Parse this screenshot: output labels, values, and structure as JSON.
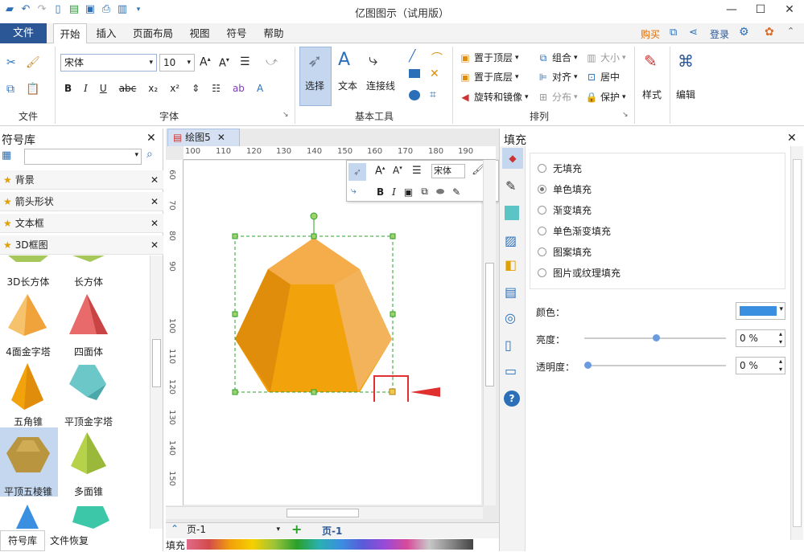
{
  "window": {
    "title": "亿图图示（试用版）"
  },
  "menu": {
    "file": "文件",
    "tabs": [
      "开始",
      "插入",
      "页面布局",
      "视图",
      "符号",
      "帮助"
    ],
    "right": {
      "buy": "购买",
      "login": "登录"
    }
  },
  "ribbon": {
    "groups": {
      "file": "文件",
      "font": "字体",
      "basic_tools": "基本工具",
      "arrange": "排列"
    },
    "font_name": "宋体",
    "font_size": "10",
    "select": "选择",
    "text": "文本",
    "connector": "连接线",
    "arrange_items": [
      "置于顶层",
      "置于底层",
      "旋转和镜像",
      "组合",
      "对齐",
      "分布",
      "大小",
      "居中",
      "保护"
    ],
    "style": "样式",
    "edit": "编辑"
  },
  "sidebar": {
    "title": "符号库",
    "libraries": [
      "背景",
      "箭头形状",
      "文本框",
      "3D框图"
    ],
    "shapes": [
      {
        "label": "3D长方体",
        "icon": "cuboid-3d-icon"
      },
      {
        "label": "长方体",
        "icon": "cuboid-icon"
      },
      {
        "label": "4面金字塔",
        "icon": "pyramid-4-face-icon"
      },
      {
        "label": "四面体",
        "icon": "tetrahedron-icon"
      },
      {
        "label": "五角锥",
        "icon": "pentagonal-pyramid-icon"
      },
      {
        "label": "平顶金字塔",
        "icon": "flat-top-pyramid-icon"
      },
      {
        "label": "平顶五棱锥",
        "icon": "flat-top-pentagonal-pyramid-icon"
      },
      {
        "label": "多面锥",
        "icon": "polyhedral-cone-icon"
      }
    ],
    "bottom_tabs": [
      "符号库",
      "文件恢复"
    ]
  },
  "document": {
    "tab": "绘图5",
    "page_tab": "页-1",
    "page_select": "页-1"
  },
  "ruler": {
    "x": [
      "100",
      "110",
      "120",
      "130",
      "140",
      "150",
      "160",
      "170",
      "180",
      "190"
    ],
    "y": [
      "60",
      "70",
      "80",
      "90",
      "100",
      "110",
      "120",
      "130",
      "140",
      "150"
    ]
  },
  "floating_toolbar": {
    "font": "宋体"
  },
  "fill_panel": {
    "title": "填充",
    "options": [
      "无填充",
      "单色填充",
      "渐变填充",
      "单色渐变填充",
      "图案填充",
      "图片或纹理填充"
    ],
    "selected": "单色填充",
    "color_label": "颜色：",
    "color_value": "#3b8fe0",
    "brightness_label": "亮度：",
    "brightness_value": "0 %",
    "transparency_label": "透明度：",
    "transparency_value": "0 %"
  },
  "status": {
    "fill": "填充"
  },
  "shape_colors": {
    "front": "#f2a20a",
    "left": "#e08d0c",
    "right": "#f0ad4e",
    "top": "#f5a94a"
  },
  "accent": "#2b5797"
}
